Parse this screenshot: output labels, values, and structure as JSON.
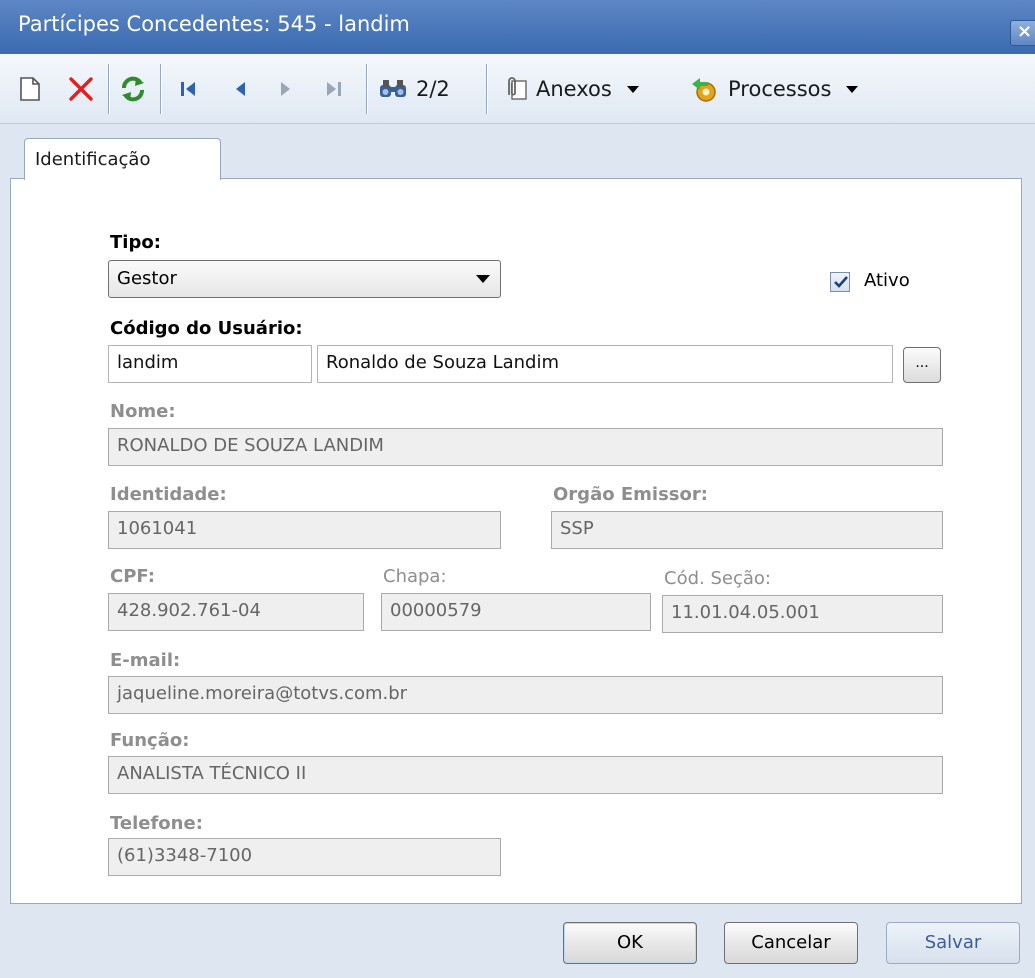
{
  "window": {
    "title": "Partícipes Concedentes: 545 - landim",
    "close_label": "×"
  },
  "toolbar": {
    "record_counter": "2/2",
    "anexos_label": "Anexos",
    "processos_label": "Processos"
  },
  "tabs": [
    {
      "label": "Identificação"
    }
  ],
  "form": {
    "tipo": {
      "label": "Tipo:",
      "value": "Gestor"
    },
    "ativo": {
      "label": "Ativo",
      "checked": true
    },
    "codigo_usuario": {
      "label": "Código do Usuário:",
      "code": "landim",
      "name": "Ronaldo de Souza Landim",
      "lookup_label": "..."
    },
    "nome": {
      "label": "Nome:",
      "value": "RONALDO DE SOUZA LANDIM"
    },
    "identidade": {
      "label": "Identidade:",
      "value": "1061041"
    },
    "orgao_emissor": {
      "label": "Orgão Emissor:",
      "value": "SSP"
    },
    "cpf": {
      "label": "CPF:",
      "value": "428.902.761-04"
    },
    "chapa": {
      "label": "Chapa:",
      "value": "00000579"
    },
    "cod_secao": {
      "label": "Cód. Seção:",
      "value": "11.01.04.05.001"
    },
    "email": {
      "label": "E-mail:",
      "value": "jaqueline.moreira@totvs.com.br"
    },
    "funcao": {
      "label": "Função:",
      "value": "ANALISTA TÉCNICO II"
    },
    "telefone": {
      "label": "Telefone:",
      "value": "(61)3348-7100"
    }
  },
  "buttons": {
    "ok": "OK",
    "cancelar": "Cancelar",
    "salvar": "Salvar"
  },
  "colors": {
    "title_bar": "#3a6ab0",
    "delete_red": "#e02020",
    "refresh_green": "#2e8b2e",
    "nav_blue": "#2f62b0"
  }
}
